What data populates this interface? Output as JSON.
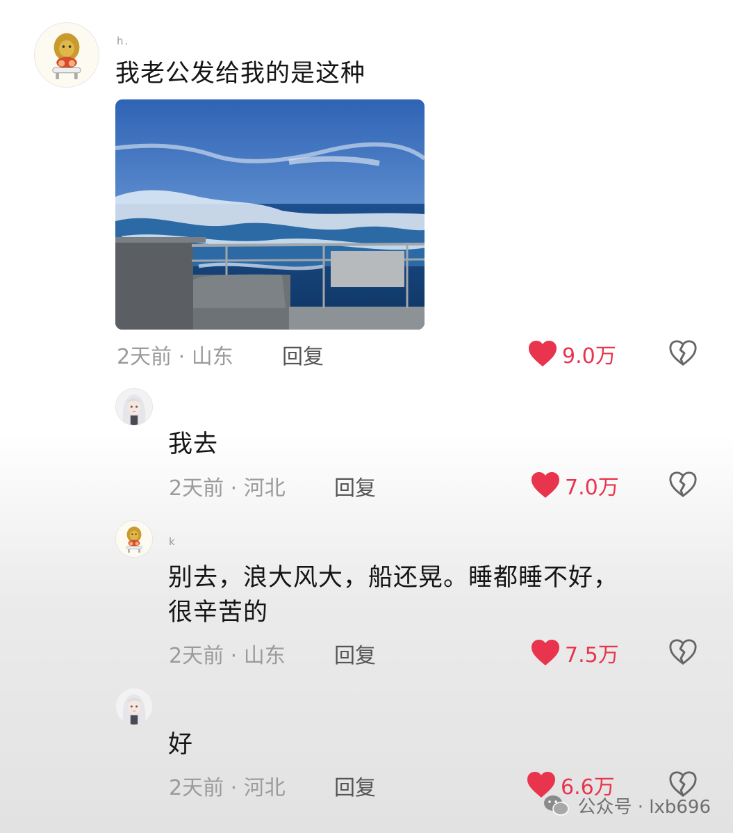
{
  "comments": [
    {
      "username": "h.",
      "text": "我老公发给我的是这种",
      "time_location": "2天前 · 山东",
      "reply_label": "回复",
      "likes": "9.0万",
      "has_image": true
    },
    {
      "username": " ",
      "text": "我去",
      "time_location": "2天前 · 河北",
      "reply_label": "回复",
      "likes": "7.0万"
    },
    {
      "username": "k",
      "text_line1": "别去，浪大风大，船还晃。睡都睡不好，",
      "text_line2": "很辛苦的",
      "time_location": "2天前 · 山东",
      "reply_label": "回复",
      "likes": "7.5万"
    },
    {
      "username": "",
      "text": "好",
      "time_location": "2天前 · 河北",
      "reply_label": "回复",
      "likes": "6.6万"
    }
  ],
  "watermark": "公众号 · lxb696",
  "colors": {
    "like_red": "#e8344d",
    "meta_gray": "#9b9b9b"
  },
  "icons": [
    "heart-icon",
    "broken-heart-icon",
    "wechat-icon"
  ]
}
